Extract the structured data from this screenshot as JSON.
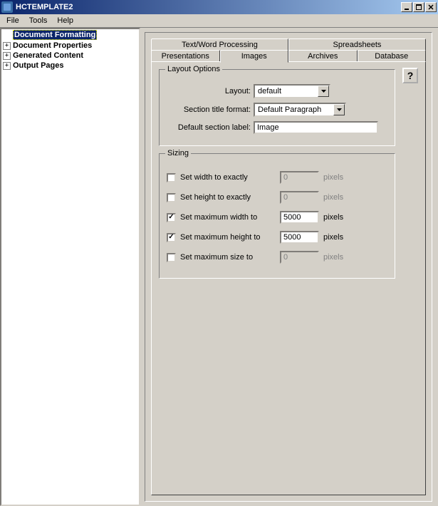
{
  "window": {
    "title": "HCTEMPLATE2"
  },
  "menu": {
    "file": "File",
    "tools": "Tools",
    "help": "Help"
  },
  "tree": {
    "items": [
      {
        "label": "Document Formatting",
        "selected": true,
        "expandable": false
      },
      {
        "label": "Document Properties",
        "selected": false,
        "expandable": true
      },
      {
        "label": "Generated Content",
        "selected": false,
        "expandable": true
      },
      {
        "label": "Output Pages",
        "selected": false,
        "expandable": true
      }
    ]
  },
  "tabs": {
    "upper": [
      "Text/Word Processing",
      "Spreadsheets"
    ],
    "lower": [
      "Presentations",
      "Images",
      "Archives",
      "Database"
    ],
    "active": "Images"
  },
  "layout_options": {
    "legend": "Layout Options",
    "layout_label": "Layout:",
    "layout_value": "default",
    "section_title_label": "Section title format:",
    "section_title_value": "Default Paragraph",
    "default_section_label": "Default section label:",
    "default_section_value": "Image"
  },
  "sizing": {
    "legend": "Sizing",
    "unit": "pixels",
    "rows": [
      {
        "label": "Set width to exactly",
        "checked": false,
        "value": "0"
      },
      {
        "label": "Set height to exactly",
        "checked": false,
        "value": "0"
      },
      {
        "label": "Set maximum width to",
        "checked": true,
        "value": "5000"
      },
      {
        "label": "Set maximum height to",
        "checked": true,
        "value": "5000"
      },
      {
        "label": "Set maximum size to",
        "checked": false,
        "value": "0"
      }
    ]
  },
  "help": "?"
}
